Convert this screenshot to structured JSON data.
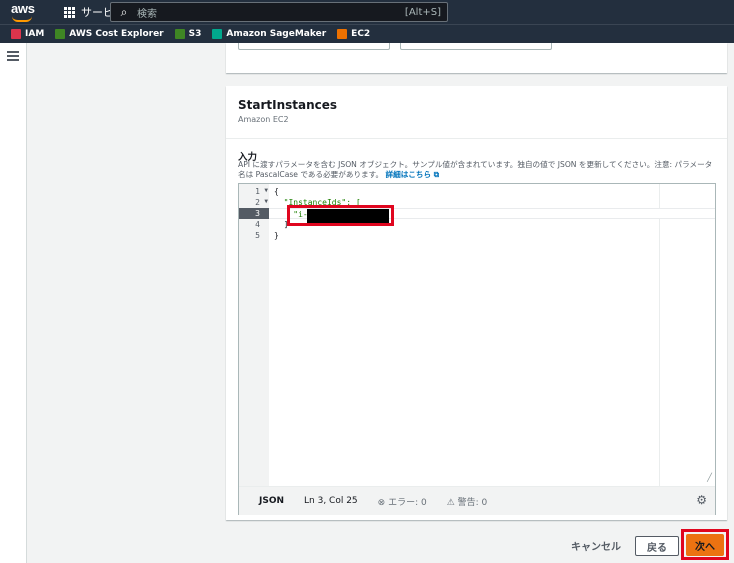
{
  "topnav": {
    "logo": "aws",
    "services_label": "サービス",
    "search_placeholder": "検索",
    "search_shortcut": "[Alt+S]"
  },
  "favorites": [
    {
      "label": "IAM",
      "icon": "iam-icon",
      "color": "#dd344c"
    },
    {
      "label": "AWS Cost Explorer",
      "icon": "cost-explorer-icon",
      "color": "#3f8624"
    },
    {
      "label": "S3",
      "icon": "s3-icon",
      "color": "#3f8624"
    },
    {
      "label": "Amazon SageMaker",
      "icon": "sagemaker-icon",
      "color": "#01a88d"
    },
    {
      "label": "EC2",
      "icon": "ec2-icon",
      "color": "#ed7100"
    }
  ],
  "step": {
    "title": "StartInstances",
    "subtitle": "Amazon EC2",
    "input_label": "入力",
    "description": "API に渡すパラメータを含む JSON オブジェクト。サンプル値が含まれています。独自の値で JSON を更新してください。注意: パラメータ名は PascalCase である必要があります。",
    "details_link": "詳細はこちら"
  },
  "editor": {
    "lines": [
      {
        "num": "1",
        "fold": "▼",
        "text": "{"
      },
      {
        "num": "2",
        "fold": "▼",
        "text": "  \"InstanceIds\": ["
      },
      {
        "num": "3",
        "fold": "",
        "text": "    \"i-"
      },
      {
        "num": "4",
        "fold": "",
        "text": "  ]"
      },
      {
        "num": "5",
        "fold": "",
        "text": "}"
      }
    ],
    "active_line": 3,
    "mode": "JSON",
    "cursor": "Ln 3, Col 25",
    "errors": "エラー: 0",
    "warnings": "警告: 0"
  },
  "footer": {
    "cancel": "キャンセル",
    "back": "戻る",
    "next": "次へ"
  },
  "colors": {
    "nav_bg": "#232f3e",
    "primary_button": "#ec7211",
    "highlight": "#e0061f"
  }
}
